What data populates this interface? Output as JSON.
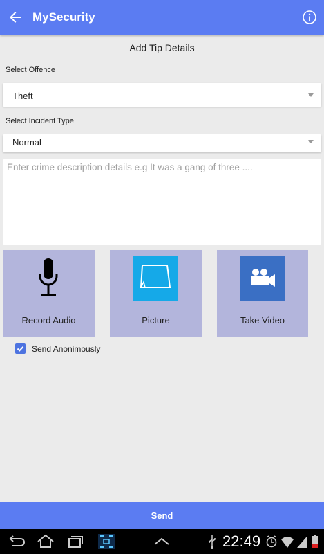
{
  "appbar": {
    "title": "MySecurity",
    "back_icon": "arrow-left-icon",
    "info_icon": "info-circle-icon",
    "color": "#5b7cf2"
  },
  "form": {
    "heading": "Add Tip Details",
    "offence_label": "Select Offence",
    "offence_value": "Theft",
    "incident_label": "Select Incident Type",
    "incident_value": "Normal",
    "description_placeholder": "Enter crime description details e.g It was a gang of three ...."
  },
  "media": [
    {
      "label": "Record Audio",
      "icon": "microphone-icon"
    },
    {
      "label": "Picture",
      "icon": "picture-icon"
    },
    {
      "label": "Take Video",
      "icon": "video-camera-icon"
    }
  ],
  "anonymous": {
    "label": "Send Anonimously",
    "checked": true
  },
  "send_label": "Send",
  "status": {
    "time": "22:49"
  }
}
